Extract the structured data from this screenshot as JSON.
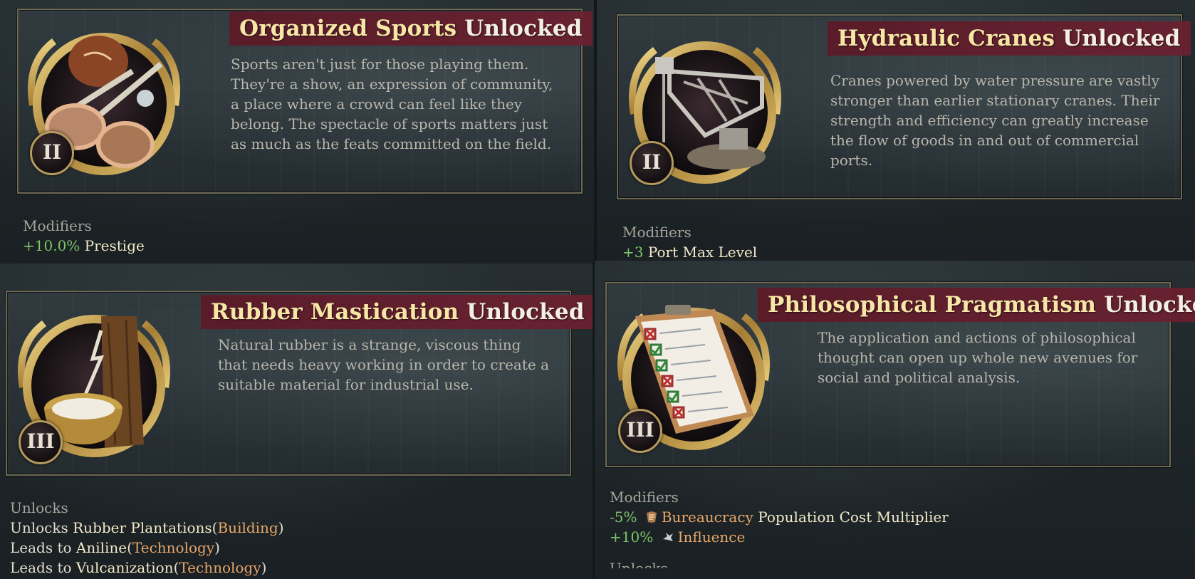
{
  "cards": [
    {
      "title_name": "Organized Sports",
      "title_suffix": "Unlocked",
      "tier": "II",
      "description": "Sports aren't just for those playing them. They're a show, an expression of community, a place where a crowd can feel like they belong. The spectacle of sports matters just as much as the feats committed on the field.",
      "section_header": "Modifiers",
      "modifier": {
        "value": "+10.0%",
        "label": "Prestige"
      },
      "icon": "sports-rackets-ball-icon"
    },
    {
      "title_name": "Hydraulic Cranes",
      "title_suffix": "Unlocked",
      "tier": "II",
      "description": "Cranes powered by water pressure are vastly stronger than earlier stationary cranes. Their strength and efficiency can greatly increase the flow of goods in and out of commercial ports.",
      "section_header": "Modifiers",
      "modifier": {
        "value": "+3",
        "label": "Port Max Level"
      },
      "icon": "crane-icon"
    },
    {
      "title_name": "Rubber Mastication",
      "title_suffix": "Unlocked",
      "tier": "III",
      "description": "Natural rubber is a strange, viscous thing that needs heavy working in order to create a suitable material for industrial use.",
      "section_header": "Unlocks",
      "unlocks": [
        {
          "prefix": "Unlocks",
          "name": "Rubber Plantations",
          "kind": "Building"
        },
        {
          "prefix": "Leads to",
          "name": "Aniline",
          "kind": "Technology"
        },
        {
          "prefix": "Leads to",
          "name": "Vulcanization",
          "kind": "Technology"
        }
      ],
      "icon": "rubber-tree-bowl-icon"
    },
    {
      "title_name": "Philosophical Pragmatism",
      "title_suffix": "Unlocked",
      "tier": "III",
      "description": "The application and actions of philosophical thought can open up whole new avenues for social and political analysis.",
      "section_header": "Modifiers",
      "modifiers": [
        {
          "value": "-5%",
          "icon": "bureaucracy-icon",
          "label": "Bureaucracy",
          "rest": "Population Cost Multiplier"
        },
        {
          "value": "+10%",
          "icon": "influence-icon",
          "label": "Influence",
          "rest": ""
        }
      ],
      "cut_off_header": "Unlocks",
      "icon": "clipboard-checklist-icon"
    }
  ],
  "open_paren": "(",
  "close_paren": ")",
  "colors": {
    "title_bg": "#5c1a28",
    "title_name": "#f6e7a6",
    "positive": "#7cc46a",
    "link": "#e8a76a",
    "frame_gold": "#b59a5c"
  }
}
